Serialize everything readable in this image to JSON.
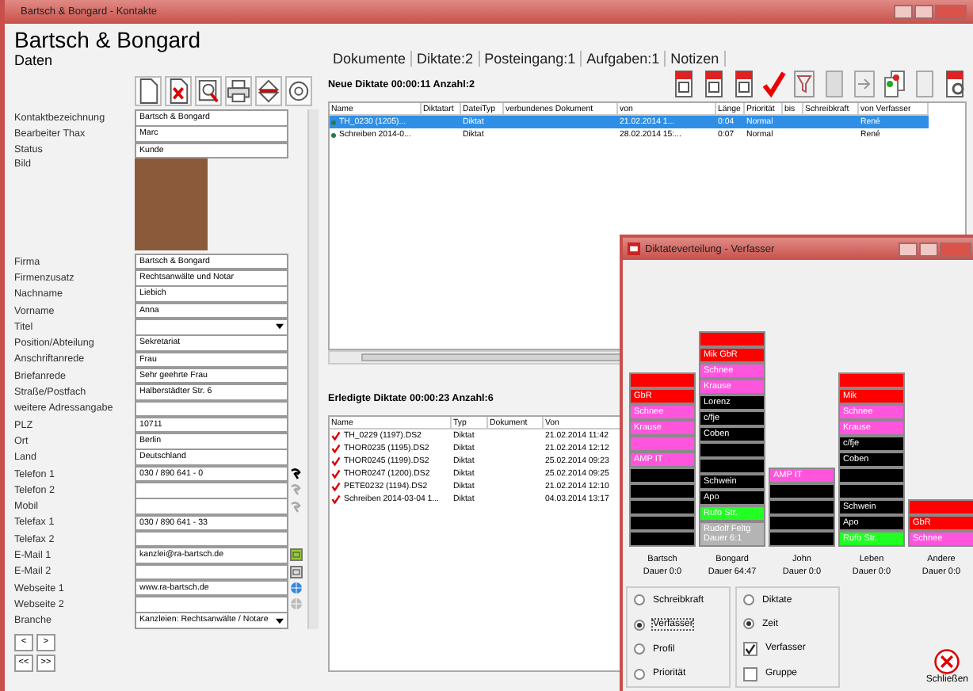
{
  "window": {
    "title": "Bartsch & Bongard - Kontakte"
  },
  "contact": {
    "name": "Bartsch & Bongard",
    "section": "Daten"
  },
  "fields": [
    {
      "kind": "text",
      "label": "Kontaktbezeichnung",
      "value": "Bartsch & Bongard"
    },
    {
      "kind": "text",
      "label": "Bearbeiter Thax",
      "value": "Marc"
    },
    {
      "kind": "text",
      "label": "Status",
      "value": "Kunde"
    },
    {
      "kind": "photo",
      "label": "Bild"
    },
    {
      "kind": "text",
      "label": "Firma",
      "value": "Bartsch & Bongard"
    },
    {
      "kind": "text",
      "label": "Firmenzusatz",
      "value": "Rechtsanwälte und Notar"
    },
    {
      "kind": "text",
      "label": "Nachname",
      "value": "Liebich"
    },
    {
      "kind": "text",
      "label": "Vorname",
      "value": "Anna"
    },
    {
      "kind": "select",
      "label": "Titel"
    },
    {
      "kind": "text",
      "label": "Position/Abteilung",
      "value": "Sekretariat"
    },
    {
      "kind": "text",
      "label": "Anschriftanrede",
      "value": "Frau"
    },
    {
      "kind": "text",
      "label": "Briefanrede",
      "value": "Sehr geehrte Frau"
    },
    {
      "kind": "text",
      "label": "Straße/Postfach",
      "value": "Halberstädter Str. 6"
    },
    {
      "kind": "text",
      "label": "weitere Adressangabe"
    },
    {
      "kind": "text",
      "label": "PLZ",
      "value": "10711"
    },
    {
      "kind": "text",
      "label": "Ort",
      "value": "Berlin"
    },
    {
      "kind": "text",
      "label": "Land",
      "value": "Deutschland"
    },
    {
      "kind": "text",
      "label": "Telefon 1",
      "value": "030 / 890 641 - 0",
      "button": {
        "kind": "phone",
        "enabled": true
      }
    },
    {
      "kind": "text",
      "label": "Telefon 2",
      "button": {
        "kind": "phone",
        "enabled": false
      }
    },
    {
      "kind": "text",
      "label": "Mobil",
      "button": {
        "kind": "phone",
        "enabled": false
      }
    },
    {
      "kind": "text",
      "label": "Telefax 1",
      "value": "030 / 890 641 - 33"
    },
    {
      "kind": "text",
      "label": "Telefax 2"
    },
    {
      "kind": "text",
      "label": "E-Mail 1",
      "value": "kanzlei@ra-bartsch.de",
      "button": {
        "kind": "mail",
        "enabled": true
      }
    },
    {
      "kind": "text",
      "label": "E-Mail 2",
      "button": {
        "kind": "mail",
        "enabled": false
      }
    },
    {
      "kind": "text",
      "label": "Webseite 1",
      "value": "www.ra-bartsch.de",
      "button": {
        "kind": "web",
        "enabled": true
      }
    },
    {
      "kind": "text",
      "label": "Webseite 2",
      "button": {
        "kind": "web",
        "enabled": false
      }
    },
    {
      "kind": "select",
      "label": "Branche",
      "value": "Kanzleien: Rechtsanwälte / Notare"
    }
  ],
  "nav_buttons": [
    "<",
    ">",
    "<<",
    ">>"
  ],
  "tabs": [
    {
      "label": "Dokumente"
    },
    {
      "label": "Diktate:2"
    },
    {
      "label": "Posteingang:1"
    },
    {
      "label": "Aufgaben:1"
    },
    {
      "label": "Notizen"
    }
  ],
  "new_dictations": {
    "heading": "Neue Diktate 00:00:11 Anzahl:2",
    "columns": [
      "Name",
      "Diktatart",
      "DateiTyp",
      "verbundenes Dokument",
      "von",
      "Länge",
      "Priorität",
      "bis",
      "Schreibkraft",
      "von Verfasser"
    ],
    "rows": [
      {
        "selected": true,
        "cells": [
          "TH_0230 (1205)...",
          "",
          "Diktat",
          "",
          "21.02.2014 1...",
          "0:04",
          "Normal",
          "",
          "",
          "René"
        ]
      },
      {
        "selected": false,
        "cells": [
          "Schreiben 2014-0...",
          "",
          "Diktat",
          "",
          "28.02.2014 15:...",
          "0:07",
          "Normal",
          "",
          "",
          "René"
        ]
      }
    ]
  },
  "done_dictations": {
    "heading": "Erledigte Diktate 00:00:23 Anzahl:6",
    "columns": [
      "Name",
      "Typ",
      "Dokument",
      "Von"
    ],
    "rows": [
      {
        "cells": [
          "TH_0229 (1197).DS2",
          "Diktat",
          "",
          "21.02.2014 11:42"
        ]
      },
      {
        "cells": [
          "THOR0235 (1195).DS2",
          "Diktat",
          "",
          "21.02.2014 12:12"
        ]
      },
      {
        "cells": [
          "THOR0245 (1199).DS2",
          "Diktat",
          "",
          "25.02.2014 09:23"
        ]
      },
      {
        "cells": [
          "THOR0247 (1200).DS2",
          "Diktat",
          "",
          "25.02.2014 09:25"
        ]
      },
      {
        "cells": [
          "PETE0232 (1194).DS2",
          "Diktat",
          "",
          "21.02.2014 12:10"
        ]
      },
      {
        "cells": [
          "Schreiben 2014-03-04 1...",
          "Diktat",
          "",
          "04.03.2014 13:17"
        ]
      }
    ]
  },
  "dialog": {
    "title": "Diktateverteilung - Verfasser",
    "columns": [
      {
        "name": "Bartsch",
        "duration": "Dauer 0:0",
        "blocks": [
          {
            "color": "#ff0000"
          },
          {
            "color": "#ff0000",
            "label": "GbR"
          },
          {
            "color": "#ff55dd",
            "label": "Schnee"
          },
          {
            "color": "#ff55dd",
            "label": "Krause"
          },
          {
            "color": "#ff55dd"
          },
          {
            "color": "#ff55dd",
            "label": "AMP IT"
          },
          {
            "color": "#000000"
          },
          {
            "color": "#000000"
          },
          {
            "color": "#000000"
          },
          {
            "color": "#000000"
          },
          {
            "color": "#000000"
          }
        ]
      },
      {
        "name": "Bongard",
        "duration": "Dauer 64:47",
        "blocks": [
          {
            "color": "#ff0000"
          },
          {
            "color": "#ff0000",
            "label": "Mik GbR"
          },
          {
            "color": "#ff55dd",
            "label": "Schnee"
          },
          {
            "color": "#ff55dd",
            "label": "Krause"
          },
          {
            "color": "#000000",
            "label": "Lorenz"
          },
          {
            "color": "#000000",
            "label": "c/fje"
          },
          {
            "color": "#000000",
            "label": "Coben"
          },
          {
            "color": "#000000"
          },
          {
            "color": "#000000"
          },
          {
            "color": "#000000",
            "label": "Schwein"
          },
          {
            "color": "#000000",
            "label": "Apo"
          },
          {
            "color": "#22ff22",
            "label": "Rufo Str."
          },
          {
            "color": "#b4b4b4",
            "label": "Rudolf Feltg Dauer 6:1"
          }
        ]
      },
      {
        "name": "John",
        "duration": "Dauer 0:0",
        "blocks": [
          {
            "color": "#ff55dd",
            "label": "AMP IT"
          },
          {
            "color": "#000000"
          },
          {
            "color": "#000000"
          },
          {
            "color": "#000000"
          },
          {
            "color": "#000000"
          }
        ]
      },
      {
        "name": "Leben",
        "duration": "Dauer 0:0",
        "blocks": [
          {
            "color": "#ff0000"
          },
          {
            "color": "#ff0000",
            "label": "Mik"
          },
          {
            "color": "#ff55dd",
            "label": "Schnee"
          },
          {
            "color": "#ff55dd",
            "label": "Krause"
          },
          {
            "color": "#000000",
            "label": "c/fje"
          },
          {
            "color": "#000000",
            "label": "Coben"
          },
          {
            "color": "#000000"
          },
          {
            "color": "#000000"
          },
          {
            "color": "#000000",
            "label": "Schwein"
          },
          {
            "color": "#000000",
            "label": "Apo"
          },
          {
            "color": "#22ff22",
            "label": "Rufo Str."
          }
        ]
      },
      {
        "name": "Andere",
        "duration": "Dauer 0:0",
        "blocks": [
          {
            "color": "#ff0000"
          },
          {
            "color": "#ff0000",
            "label": "GbR"
          },
          {
            "color": "#ff55dd",
            "label": "Schnee"
          }
        ]
      }
    ],
    "group_1": [
      {
        "label": "Schreibkraft",
        "selected": false
      },
      {
        "label": "Verfasser",
        "selected": true
      },
      {
        "label": "Profil",
        "selected": false
      },
      {
        "label": "Priorität",
        "selected": false
      }
    ],
    "group_2": [
      {
        "kind": "radio",
        "label": "Diktate",
        "selected": false
      },
      {
        "kind": "radio",
        "label": "Zeit",
        "selected": true
      },
      {
        "kind": "checkbox",
        "label": "Verfasser",
        "checked": true
      },
      {
        "kind": "checkbox",
        "label": "Gruppe",
        "checked": false
      }
    ],
    "close_button": "Schließen"
  }
}
